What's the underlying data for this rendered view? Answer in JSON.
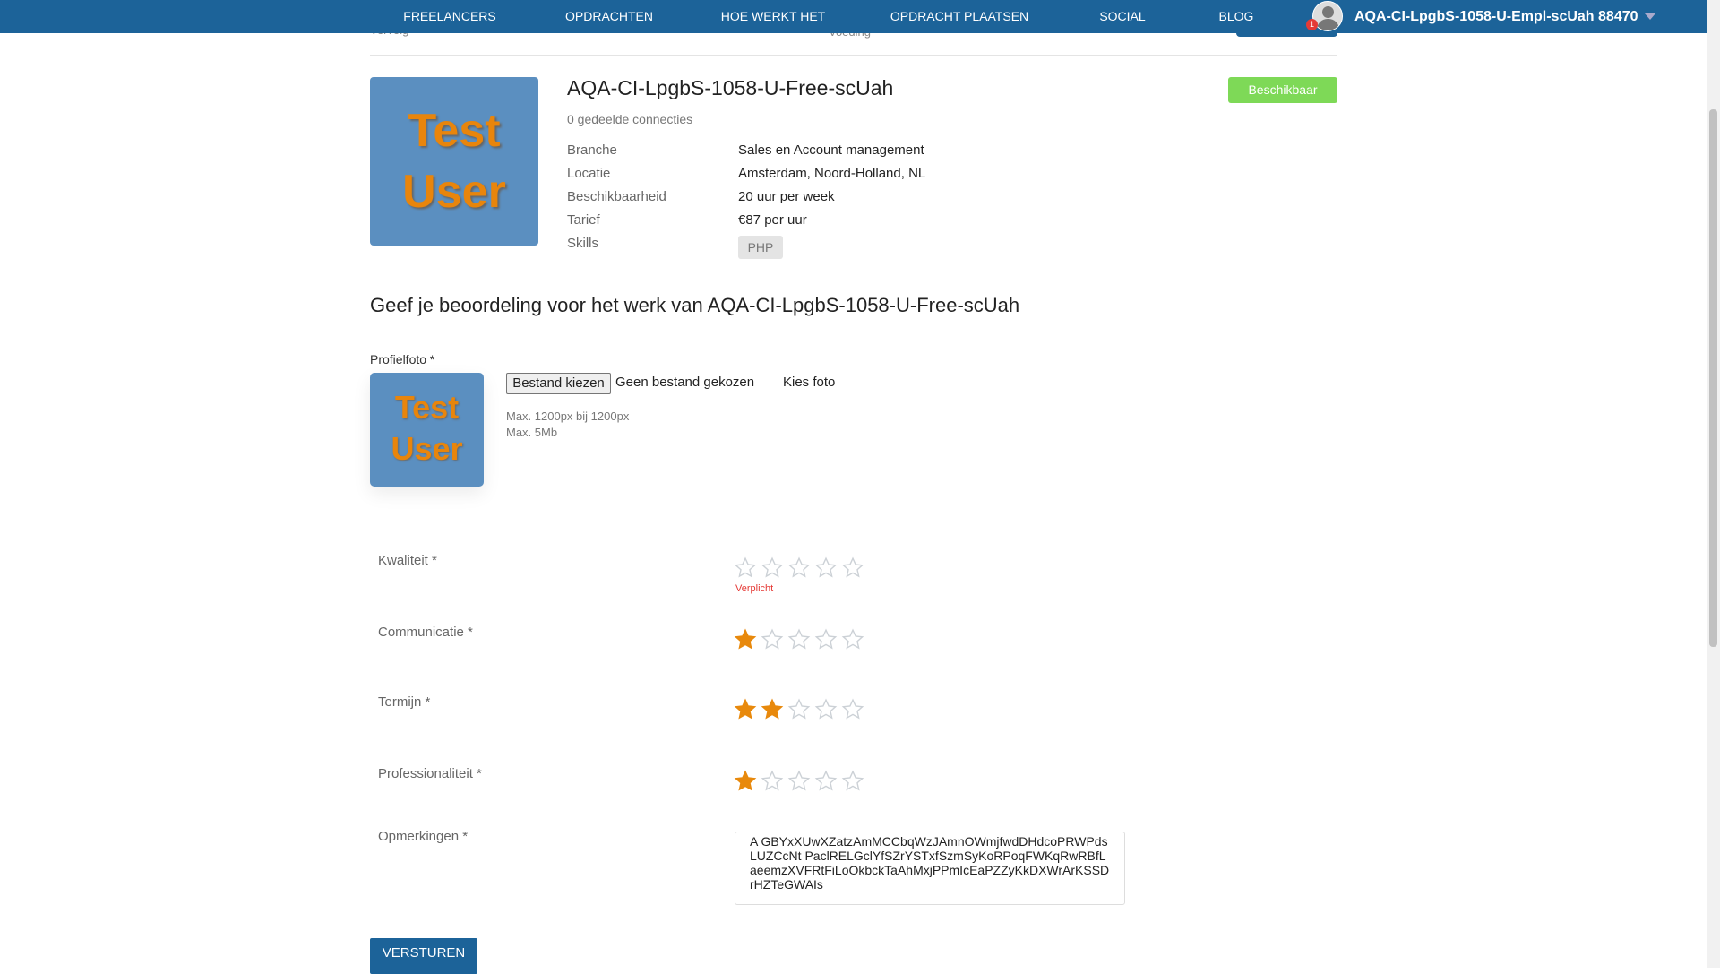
{
  "nav": {
    "items": [
      "FREELANCERS",
      "OPDRACHTEN",
      "HOE WERKT HET",
      "OPDRACHT PLAATSEN",
      "SOCIAL",
      "BLOG"
    ],
    "username": "AQA-CI-LpgbS-1058-U-Empl-scUah 88470",
    "notification_count": "1"
  },
  "hidden_header": {
    "left": "Vervolg",
    "middle": "Voeding"
  },
  "profile": {
    "image_text": [
      "Test",
      "User"
    ],
    "name": "AQA-CI-LpgbS-1058-U-Free-scUah",
    "connections": "0 gedeelde connecties",
    "status": "Beschikbaar",
    "rows": [
      {
        "label": "Branche",
        "value": "Sales en Account management"
      },
      {
        "label": "Locatie",
        "value": "Amsterdam, Noord-Holland, NL"
      },
      {
        "label": "Beschikbaarheid",
        "value": "20 uur per week"
      },
      {
        "label": "Tarief",
        "value": "€87 per uur"
      }
    ],
    "skills_label": "Skills",
    "skills": [
      "PHP"
    ]
  },
  "review": {
    "heading": "Geef je beoordeling voor het werk van AQA-CI-LpgbS-1058-U-Free-scUah",
    "photo_label": "Profielfoto *",
    "file_button": "Bestand kiezen",
    "file_status": "Geen bestand gekozen",
    "choose_photo": "Kies foto",
    "hint1": "Max. 1200px bij 1200px",
    "hint2": "Max. 5Mb",
    "ratings": [
      {
        "label": "Kwaliteit *",
        "value": 0,
        "error": "Verplicht"
      },
      {
        "label": "Communicatie *",
        "value": 1
      },
      {
        "label": "Termijn *",
        "value": 2
      },
      {
        "label": "Professionaliteit *",
        "value": 1
      }
    ],
    "max_stars": 5,
    "remarks_label": "Opmerkingen *",
    "remarks_value": "A GBYxXUwXZatzAmMCCbqWzJAmnOWmjfwdDHdcoPRWPdsLUZCcNt PaclRELGclYfSZrYSTxfSzmSyKoRPoqFWKqRwRBfLaeemzXVFRtFiLoOkbckTaAhMxjPPmIcEaPZZyKkDXWrArKSSDrHZTeGWAIs",
    "submit": "VERSTUREN"
  },
  "colors": {
    "nav": "#1c6399",
    "accent_star": "#e8890c",
    "status": "#7ed957",
    "error": "#e53935"
  }
}
